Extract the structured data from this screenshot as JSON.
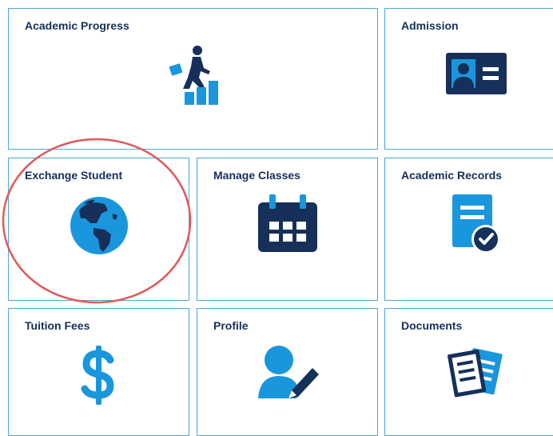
{
  "tiles": [
    {
      "title": "Academic Progress",
      "icon": "climbing-stairs-icon"
    },
    {
      "title": "Admission",
      "icon": "id-card-icon"
    },
    {
      "title": "Exchange Student",
      "icon": "globe-icon"
    },
    {
      "title": "Manage Classes",
      "icon": "calendar-icon"
    },
    {
      "title": "Academic Records",
      "icon": "document-check-icon"
    },
    {
      "title": "Tuition Fees",
      "icon": "dollar-icon"
    },
    {
      "title": "Profile",
      "icon": "user-edit-icon"
    },
    {
      "title": "Documents",
      "icon": "documents-icon"
    }
  ],
  "colors": {
    "border": "#4aa8dc",
    "title": "#16305a",
    "icon_light": "#1a96dc",
    "icon_dark": "#16305a",
    "highlight": "#e05a5a"
  }
}
